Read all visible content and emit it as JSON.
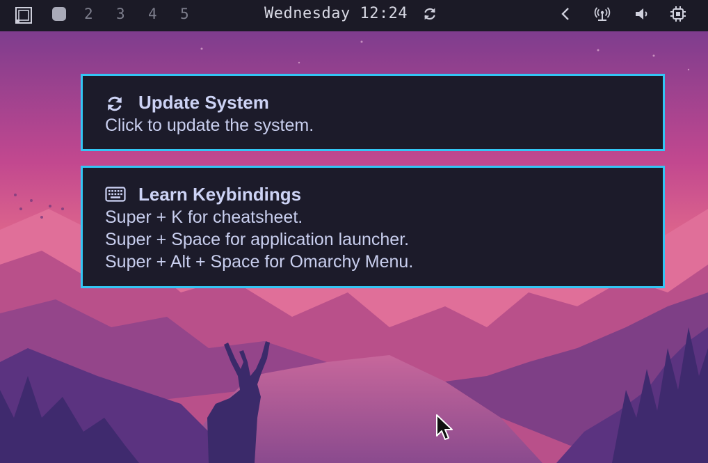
{
  "topbar": {
    "logo_icon": "omarchy-logo-icon",
    "workspaces": [
      "2",
      "3",
      "4",
      "5"
    ],
    "clock": "Wednesday 12:24",
    "tray_icons": [
      "chevron-left-icon",
      "wifi-icon",
      "volume-icon",
      "cpu-icon"
    ]
  },
  "notifications": [
    {
      "icon": "refresh-icon",
      "title": "Update System",
      "lines": [
        "Click to update the system."
      ]
    },
    {
      "icon": "keyboard-icon",
      "title": "Learn Keybindings",
      "lines": [
        "Super + K for cheatsheet.",
        "Super + Space for application launcher.",
        "Super + Alt + Space for Omarchy Menu."
      ]
    }
  ],
  "colors": {
    "bar_bg": "#1b1a26",
    "notif_bg": "#1c1b2a",
    "notif_border": "#33c6f4",
    "text": "#c9cfef"
  }
}
